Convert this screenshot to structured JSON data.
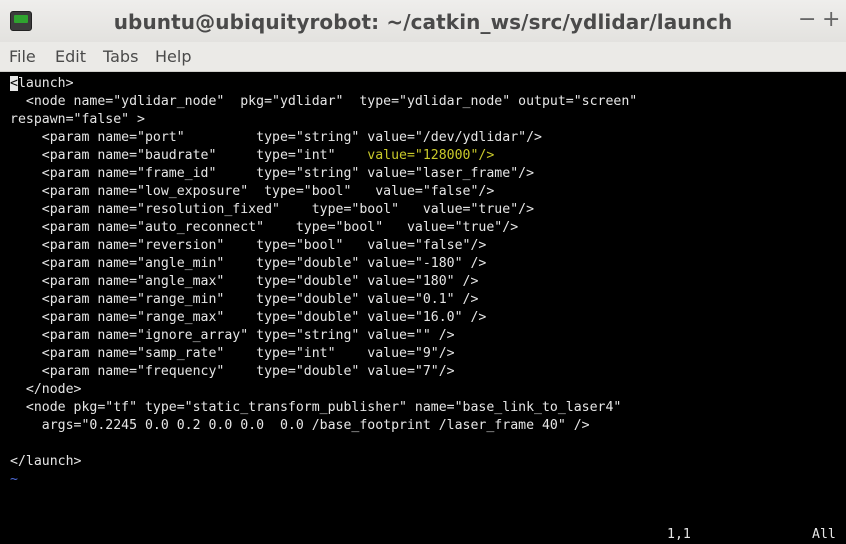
{
  "window": {
    "title": "ubuntu@ubiquityrobot: ~/catkin_ws/src/ydlidar/launch",
    "minimize": "−",
    "maximize": "+"
  },
  "menu": [
    "File",
    "Edit",
    "Tabs",
    "Help"
  ],
  "editor": {
    "cursor_char": "<",
    "line1_rest": "launch>",
    "lines": [
      "  <node name=\"ydlidar_node\"  pkg=\"ydlidar\"  type=\"ydlidar_node\" output=\"screen\"",
      "respawn=\"false\" >",
      "    <param name=\"port\"         type=\"string\" value=\"/dev/ydlidar\"/>",
      "    <param name=\"baudrate\"     type=\"int\"    ",
      "    <param name=\"frame_id\"     type=\"string\" value=\"laser_frame\"/>",
      "    <param name=\"low_exposure\"  type=\"bool\"   value=\"false\"/>",
      "    <param name=\"resolution_fixed\"    type=\"bool\"   value=\"true\"/>",
      "    <param name=\"auto_reconnect\"    type=\"bool\"   value=\"true\"/>",
      "    <param name=\"reversion\"    type=\"bool\"   value=\"false\"/>",
      "    <param name=\"angle_min\"    type=\"double\" value=\"-180\" />",
      "    <param name=\"angle_max\"    type=\"double\" value=\"180\" />",
      "    <param name=\"range_min\"    type=\"double\" value=\"0.1\" />",
      "    <param name=\"range_max\"    type=\"double\" value=\"16.0\" />",
      "    <param name=\"ignore_array\" type=\"string\" value=\"\" />",
      "    <param name=\"samp_rate\"    type=\"int\"    value=\"9\"/>",
      "    <param name=\"frequency\"    type=\"double\" value=\"7\"/>",
      "  </node>",
      "  <node pkg=\"tf\" type=\"static_transform_publisher\" name=\"base_link_to_laser4\"",
      "    args=\"0.2245 0.0 0.2 0.0 0.0  0.0 /base_footprint /laser_frame 40\" />",
      "",
      "</launch>",
      "~"
    ],
    "highlight": "value=\"128000\"/>",
    "position": "1,1",
    "scroll": "All"
  }
}
